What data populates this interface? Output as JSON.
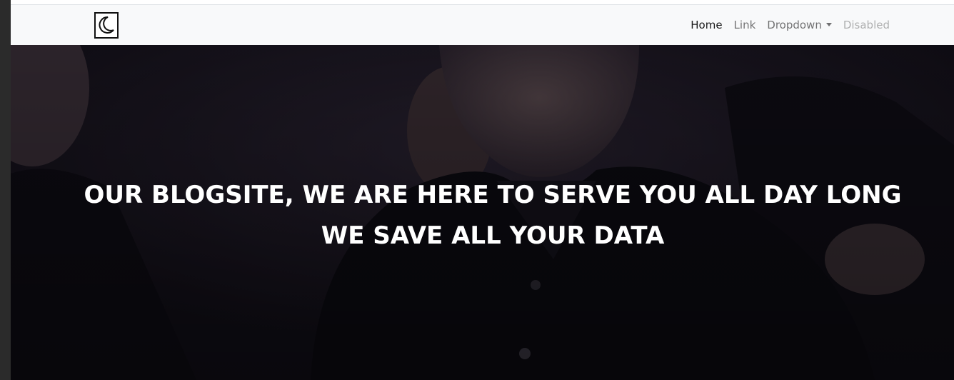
{
  "navbar": {
    "brand_icon": "moon-icon",
    "links": [
      {
        "label": "Home",
        "state": "active"
      },
      {
        "label": "Link",
        "state": "normal"
      },
      {
        "label": "Dropdown",
        "state": "normal"
      },
      {
        "label": "Disabled",
        "state": "disabled"
      }
    ]
  },
  "hero": {
    "line1": "OUR BLOGSITE, WE ARE HERE TO SERVE YOU ALL DAY LONG",
    "line2": "WE SAVE ALL YOUR DATA",
    "text_color": "#ffffff",
    "background": "#14111c"
  },
  "colors": {
    "navbar_bg": "#f8f9fa",
    "window_frame": "#2b2b2b"
  }
}
